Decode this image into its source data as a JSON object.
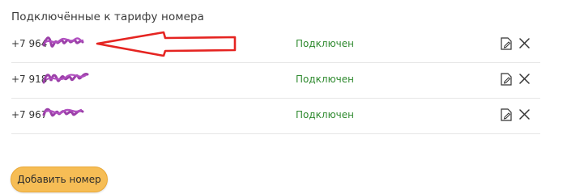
{
  "section": {
    "title": "Подключённые к тарифу номера"
  },
  "numbers": [
    {
      "prefix": "+7 964",
      "status": "Подключен"
    },
    {
      "prefix": "+7 918",
      "status": "Подключен"
    },
    {
      "prefix": "+7 967",
      "status": "Подключен"
    }
  ],
  "actions": {
    "add_label": "Добавить номер"
  },
  "colors": {
    "status_connected": "#2f8a2f",
    "scribble": "#9b3fa8",
    "arrow": "#e52421",
    "button_bg": "#f6bd55"
  },
  "icons": {
    "edit": "edit-icon",
    "delete": "close-icon"
  }
}
